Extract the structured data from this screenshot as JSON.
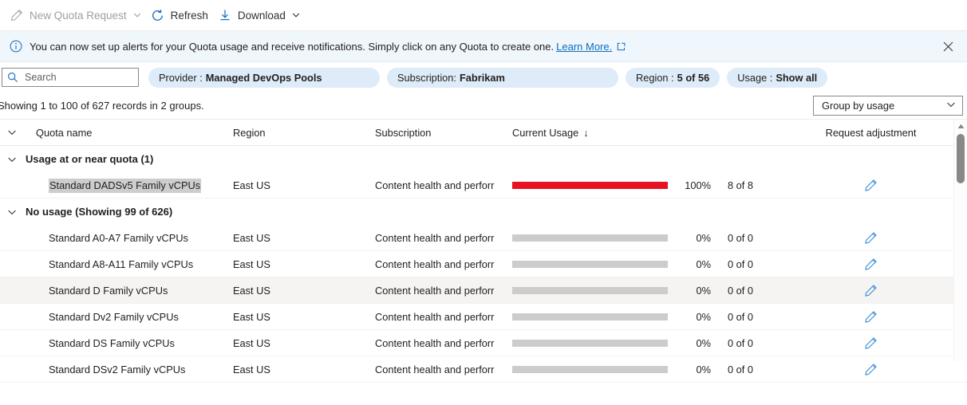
{
  "toolbar": {
    "new_request": {
      "label": "New Quota Request",
      "icon": "pencil-icon",
      "disabled": true
    },
    "refresh": {
      "label": "Refresh",
      "icon": "refresh-icon"
    },
    "download": {
      "label": "Download",
      "icon": "download-icon"
    }
  },
  "banner": {
    "icon": "info-icon",
    "text": "You can now set up alerts for your Quota usage and receive notifications. Simply click on any Quota to create one.",
    "link_label": "Learn More.",
    "external_icon": "external-link-icon",
    "close_icon": "close-icon"
  },
  "filters": {
    "search": {
      "placeholder": "Search",
      "value": "",
      "icon": "search-icon"
    },
    "pills": [
      {
        "label": "Provider :",
        "value": "Managed DevOps Pools",
        "name": "filter-provider"
      },
      {
        "label": "Subscription:",
        "value": "Fabrikam",
        "name": "filter-subscription"
      },
      {
        "label": "Region :",
        "value": "5 of 56",
        "name": "filter-region"
      },
      {
        "label": "Usage :",
        "value": "Show all",
        "name": "filter-usage"
      }
    ]
  },
  "summary": {
    "text": "Showing 1 to 100 of 627 records in 2 groups.",
    "group_by": {
      "label": "Group by usage",
      "icon": "chevron-down-icon"
    }
  },
  "table": {
    "columns": {
      "quota_name": "Quota name",
      "region": "Region",
      "subscription": "Subscription",
      "current_usage": "Current Usage",
      "sort_indicator": "↓",
      "request_adjustment": "Request adjustment"
    },
    "groups": [
      {
        "label": "Usage at or near quota (1)",
        "name": "group-usage-at-or-near-quota",
        "rows": [
          {
            "quota_name": "Standard DADSv5 Family vCPUs",
            "selected": true,
            "region": "East US",
            "subscription": "Content health and perforr",
            "percent": 100,
            "percent_label": "100%",
            "ratio": "8 of 8",
            "bar_color": "#e81123",
            "hover": false
          }
        ]
      },
      {
        "label": "No usage (Showing 99 of 626)",
        "name": "group-no-usage",
        "rows": [
          {
            "quota_name": "Standard A0-A7 Family vCPUs",
            "selected": false,
            "region": "East US",
            "subscription": "Content health and perforr",
            "percent": 0,
            "percent_label": "0%",
            "ratio": "0 of 0",
            "bar_color": "#cccccc",
            "hover": false
          },
          {
            "quota_name": "Standard A8-A11 Family vCPUs",
            "selected": false,
            "region": "East US",
            "subscription": "Content health and perforr",
            "percent": 0,
            "percent_label": "0%",
            "ratio": "0 of 0",
            "bar_color": "#cccccc",
            "hover": false
          },
          {
            "quota_name": "Standard D Family vCPUs",
            "selected": false,
            "region": "East US",
            "subscription": "Content health and perforr",
            "percent": 0,
            "percent_label": "0%",
            "ratio": "0 of 0",
            "bar_color": "#cccccc",
            "hover": true
          },
          {
            "quota_name": "Standard Dv2 Family vCPUs",
            "selected": false,
            "region": "East US",
            "subscription": "Content health and perforr",
            "percent": 0,
            "percent_label": "0%",
            "ratio": "0 of 0",
            "bar_color": "#cccccc",
            "hover": false
          },
          {
            "quota_name": "Standard DS Family vCPUs",
            "selected": false,
            "region": "East US",
            "subscription": "Content health and perforr",
            "percent": 0,
            "percent_label": "0%",
            "ratio": "0 of 0",
            "bar_color": "#cccccc",
            "hover": false
          },
          {
            "quota_name": "Standard DSv2 Family vCPUs",
            "selected": false,
            "region": "East US",
            "subscription": "Content health and perforr",
            "percent": 0,
            "percent_label": "0%",
            "ratio": "0 of 0",
            "bar_color": "#cccccc",
            "hover": false
          }
        ]
      }
    ],
    "row_action_icon": "pencil-icon"
  },
  "scrollbar": {
    "up_icon": "scroll-up-arrow-icon"
  },
  "colors": {
    "accent": "#0f6cbd",
    "banner_bg": "#eff6fc",
    "pill_bg": "#deecf9",
    "bar_full": "#e81123",
    "bar_empty": "#cccccc",
    "selection": "#cdcdcd"
  }
}
